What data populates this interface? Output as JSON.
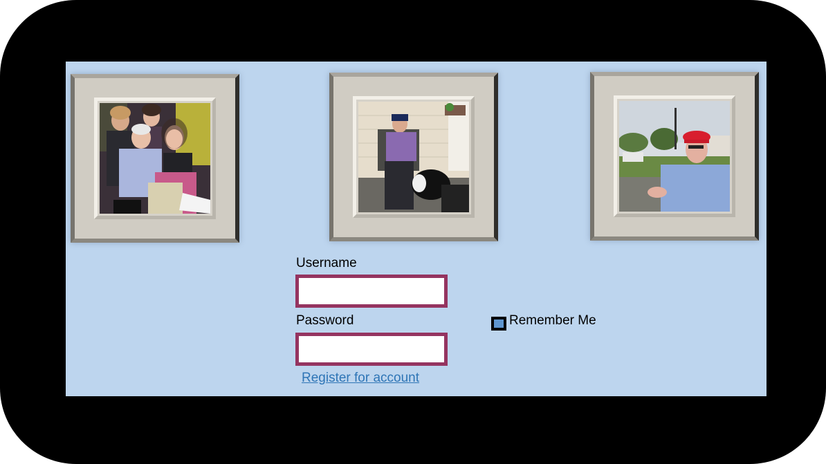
{
  "photos": [
    {
      "icon": "family-group-photo",
      "description_color": "#5b3a5e"
    },
    {
      "icon": "man-with-dog-photo",
      "description_color": "#c8c0b0"
    },
    {
      "icon": "man-red-cap-photo",
      "description_color": "#5a7a40"
    }
  ],
  "login": {
    "username_label": "Username",
    "username_value": "",
    "password_label": "Password",
    "password_value": "",
    "remember_label": "Remember Me",
    "register_link": "Register for account"
  },
  "colors": {
    "background": "#bdd5ee",
    "frame": "#000000",
    "input_border": "#953460",
    "link": "#2e75b6",
    "checkbox_fill": "#5f96cf"
  }
}
